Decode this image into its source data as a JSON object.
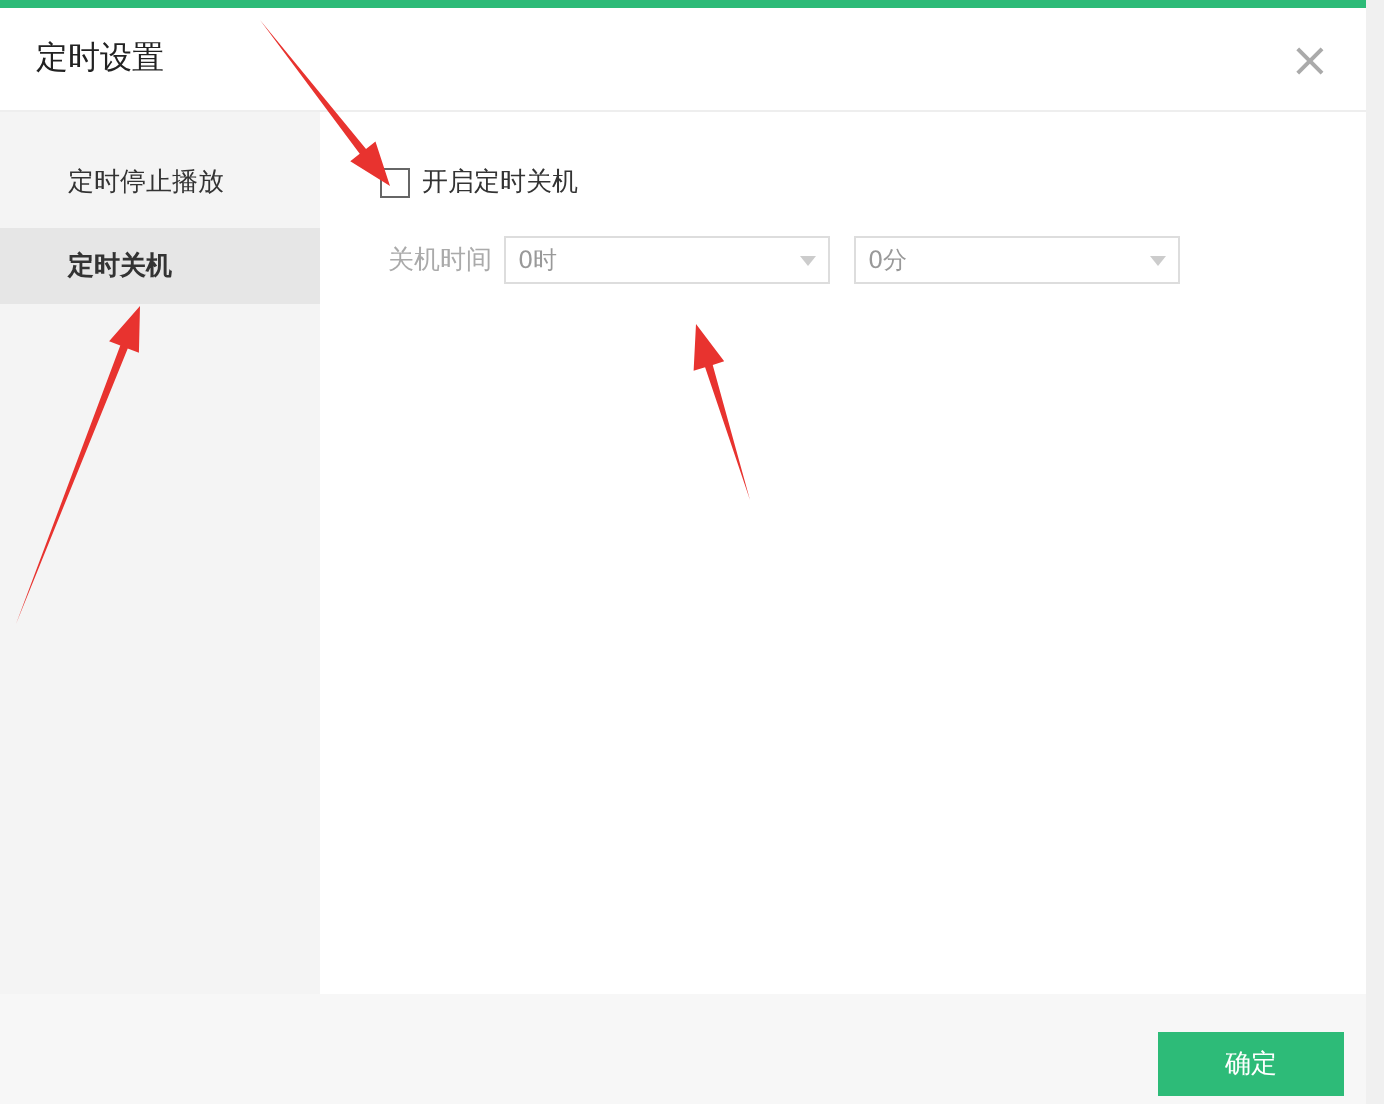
{
  "window": {
    "title": "定时设置",
    "close": "×"
  },
  "sidebar": {
    "items": [
      {
        "label": "定时停止播放",
        "selected": false
      },
      {
        "label": "定时关机",
        "selected": true
      }
    ]
  },
  "shutdown": {
    "enable": {
      "label": "开启定时关机",
      "checked": false
    },
    "time_label": "关机时间",
    "hour": {
      "value": "0时",
      "disabled": true
    },
    "minute": {
      "value": "0分",
      "disabled": true
    }
  },
  "footer": {
    "button": "确定"
  },
  "annotations": [
    {
      "kind": "arrow"
    },
    {
      "kind": "arrow"
    },
    {
      "kind": "arrow"
    }
  ]
}
